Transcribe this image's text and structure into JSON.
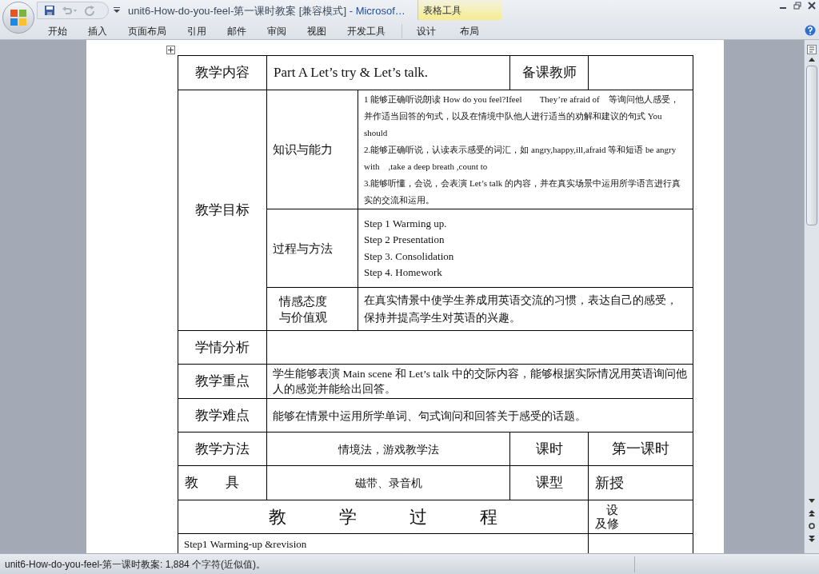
{
  "window": {
    "title": "unit6-How-do-you-feel-第一课时教案 [兼容模式]",
    "app": "- Microsof…",
    "context_group": "表格工具"
  },
  "ribbon_tabs": [
    {
      "label": "开始"
    },
    {
      "label": "插入"
    },
    {
      "label": "页面布局"
    },
    {
      "label": "引用"
    },
    {
      "label": "邮件"
    },
    {
      "label": "审阅"
    },
    {
      "label": "视图"
    },
    {
      "label": "开发工具"
    }
  ],
  "context_tabs": [
    {
      "label": "设计"
    },
    {
      "label": "布局"
    }
  ],
  "table": {
    "content": {
      "label": "教学内容",
      "value": "Part A Let’s try & Let’s talk.",
      "teacher_label": "备课教师"
    },
    "objectives": {
      "label": "教学目标",
      "knowledge_label": "知识与能力",
      "knowledge": [
        "1 能够正确听说朗读 How do you feel?Ifeel　　They’re afraid of　等询问他人感受，并作适当回答的句式，以及在情境中队他人进行适当的劝解和建议的句式 You should",
        "2.能够正确听说，认读表示感受的词汇，如 angry,happy,ill,afraid 等和短语 be angry with　,take a deep breath ,count to",
        "3.能够听懂，会说，会表演 Let’s talk 的内容，并在真实场景中运用所学语言进行真实的交流和运用。"
      ],
      "process_label": "过程与方法",
      "process": [
        "Step 1 Warming up.",
        "Step 2 Presentation",
        "Step 3. Consolidation",
        "Step 4. Homework"
      ],
      "attitude_label": [
        "情感态度",
        "与价值观"
      ],
      "attitude": "在真实情景中使学生养成用英语交流的习惯，表达自己的感受，保持并提高学生对英语的兴趣。"
    },
    "analysis": {
      "label": "学情分析"
    },
    "key_points": {
      "label": "教学重点",
      "value": "学生能够表演 Main scene  和 Let’s talk 中的交际内容，能够根据实际情况用英语询问他人的感觉并能给出回答。"
    },
    "difficulties": {
      "label": "教学难点",
      "value": "能够在情景中运用所学单词、句式询问和回答关于感受的话题。"
    },
    "method": {
      "label": "教学方法",
      "value": "情境法，游戏教学法",
      "period_label": "课时",
      "period": "第一课时"
    },
    "tools": {
      "label": "教　　具",
      "value": "磁带、录音机",
      "type_label": "课型",
      "type": "新授"
    },
    "process_header": {
      "label": "教　　　学　　　过　　　程",
      "side": [
        "设",
        "及修"
      ]
    },
    "step1": "Step1 Warming-up &revision"
  },
  "status_bar": {
    "text": "unit6-How-do-you-feel-第一课时教案: 1,884 个字符(近似值)。"
  }
}
